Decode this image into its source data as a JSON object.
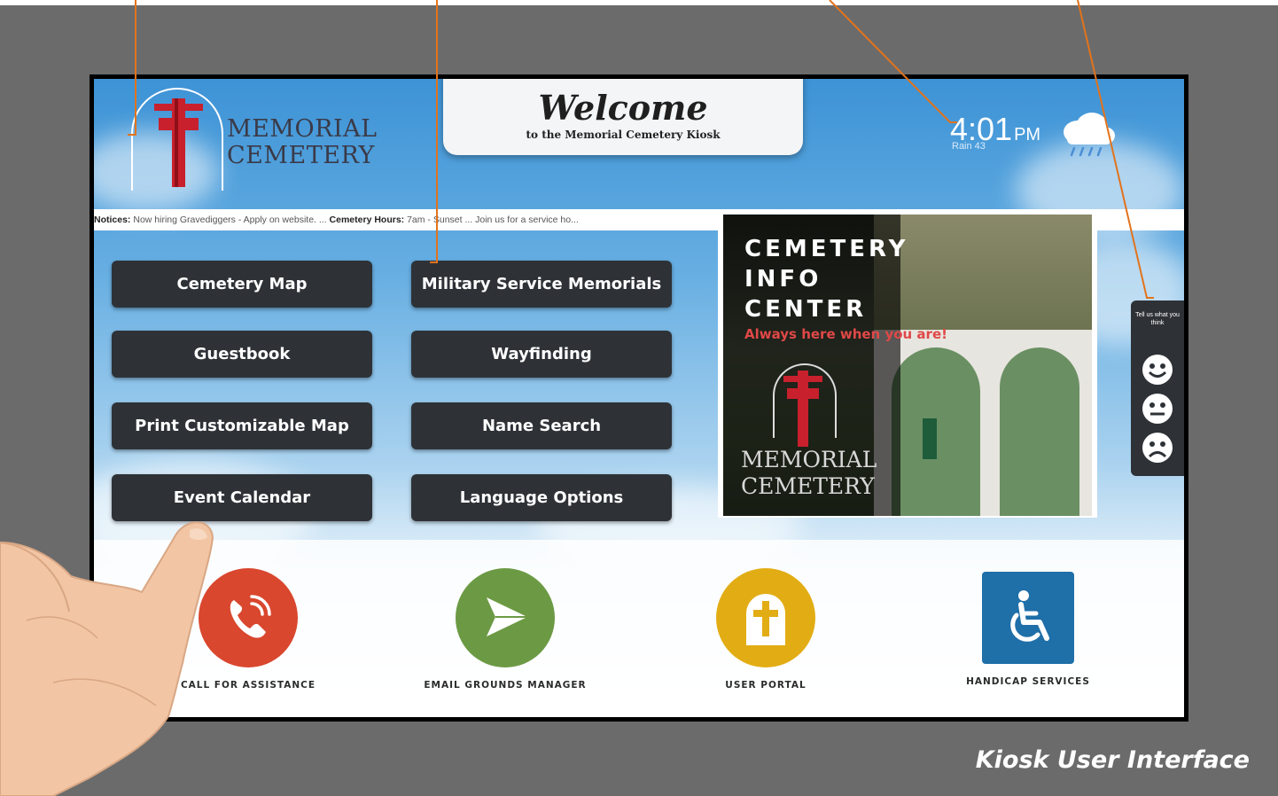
{
  "header": {
    "logo_line1": "MEMORIAL",
    "logo_line2": "CEMETERY",
    "welcome_title": "Welcome",
    "welcome_subtitle": "to the Memorial Cemetery Kiosk"
  },
  "clock": {
    "time": "4:01",
    "ampm": "PM",
    "weather_desc": "Rain 43"
  },
  "ticker": {
    "label1": "Notices:",
    "text1": " Now hiring Gravediggers - Apply on website. ... ",
    "label2": "Cemetery Hours:",
    "text2": " 7am - Sunset ... Join us for a service ho..."
  },
  "menu": {
    "cemetery_map": "Cemetery Map",
    "military_memorials": "Military Service Memorials",
    "guestbook": "Guestbook",
    "wayfinding": "Wayfinding",
    "print_map": "Print Customizable Map",
    "name_search": "Name Search",
    "event_calendar": "Event Calendar",
    "language_options": "Language Options"
  },
  "info_panel": {
    "line1": "CEMETERY",
    "line2": "INFO",
    "line3": "CENTER",
    "tagline": "Always here when you are!",
    "logo_line1": "MEMORIAL",
    "logo_line2": "CEMETERY"
  },
  "feedback": {
    "text": "Tell us what you think",
    "faces": [
      "smile-icon",
      "neutral-face-icon",
      "frown-icon"
    ]
  },
  "bottom": {
    "call": "CALL FOR ASSISTANCE",
    "email": "EMAIL GROUNDS MANAGER",
    "portal": "USER PORTAL",
    "handicap": "HANDICAP SERVICES"
  },
  "colors": {
    "call": "#d9472e",
    "email": "#6c9a44",
    "portal": "#e2ad14",
    "handicap": "#1f6fa8",
    "button": "#2e3237",
    "callout": "#e2731c"
  },
  "caption": "Kiosk User Interface"
}
